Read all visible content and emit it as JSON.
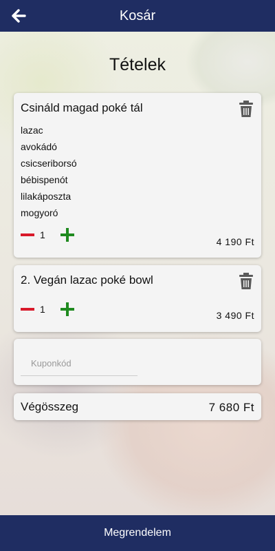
{
  "header": {
    "title": "Kosár"
  },
  "page": {
    "title": "Tételek"
  },
  "items": [
    {
      "name": "Csináld magad poké tál",
      "ingredients": [
        "lazac",
        "avokádó",
        "csicseriborsó",
        "bébispenót",
        "lilakáposzta",
        "mogyoró"
      ],
      "quantity": "1",
      "price": "4 190 Ft"
    },
    {
      "name": "2. Vegán lazac poké bowl",
      "ingredients": [],
      "quantity": "1",
      "price": "3 490 Ft"
    }
  ],
  "coupon": {
    "placeholder": "Kuponkód",
    "value": ""
  },
  "total": {
    "label": "Végösszeg",
    "value": "7 680 Ft"
  },
  "footer": {
    "order_label": "Megrendelem"
  },
  "colors": {
    "primary": "#1f2d62",
    "minus": "#d8192a",
    "plus": "#1f8a1f"
  }
}
